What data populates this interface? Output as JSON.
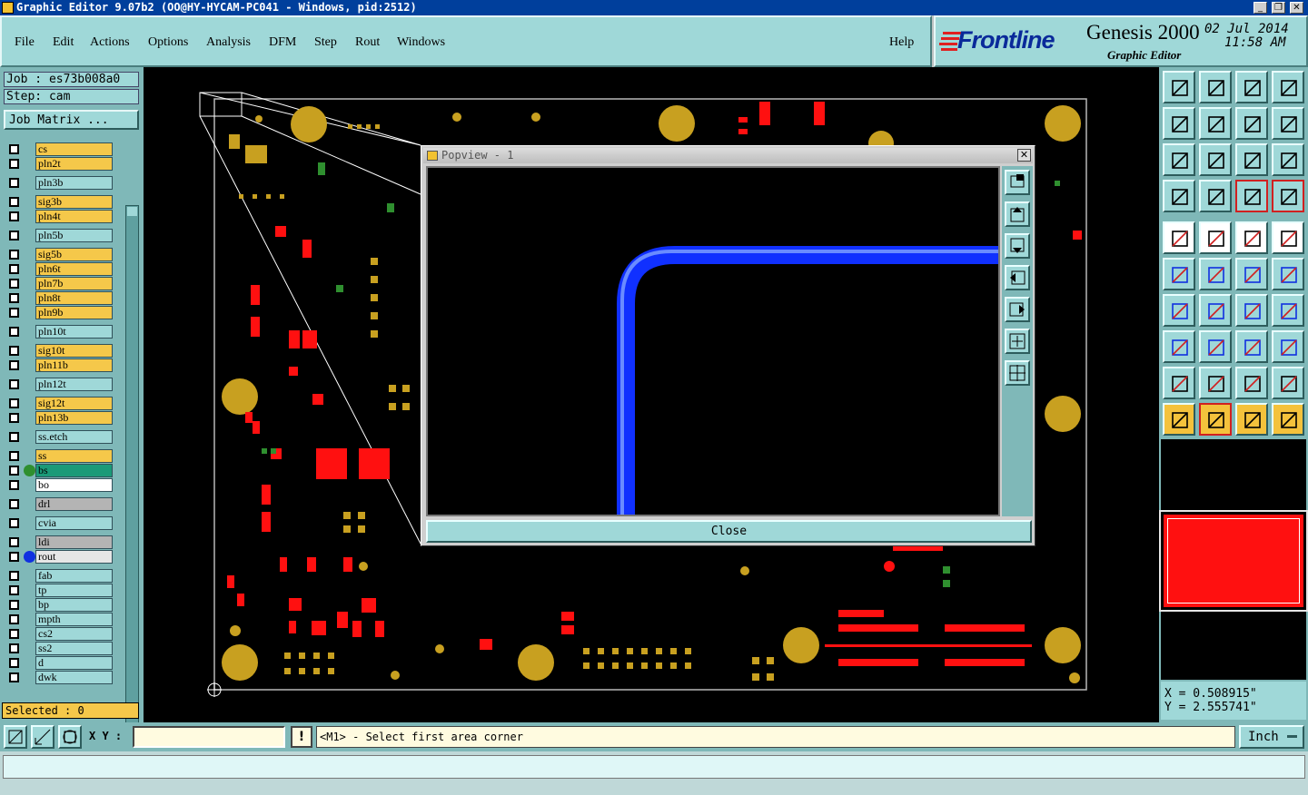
{
  "window": {
    "title": "Graphic Editor 9.07b2 (OO@HY-HYCAM-PC041 - Windows, pid:2512)",
    "minimize_glyph": "_",
    "restore_glyph": "❐",
    "close_glyph": "✕"
  },
  "menu": [
    {
      "label": "File"
    },
    {
      "label": "Edit"
    },
    {
      "label": "Actions"
    },
    {
      "label": "Options"
    },
    {
      "label": "Analysis"
    },
    {
      "label": "DFM"
    },
    {
      "label": "Step"
    },
    {
      "label": "Rout"
    },
    {
      "label": "Windows"
    },
    {
      "label": "Help"
    }
  ],
  "brand": {
    "logo": "Frontline",
    "product": "Genesis 2000",
    "subtitle": "Graphic Editor",
    "date": "02 Jul 2014",
    "time": "11:58 AM"
  },
  "job": {
    "job_line": "Job : es73b008a0",
    "step_line": "Step: cam",
    "matrix_button": "Job Matrix ..."
  },
  "layers": [
    {
      "name": "cs",
      "color": "#f5c84a"
    },
    {
      "name": "pln2t",
      "color": "#f5c84a"
    },
    {
      "name": "pln3b",
      "color": "#9fd8d8"
    },
    {
      "name": "sig3b",
      "color": "#f5c84a"
    },
    {
      "name": "pln4t",
      "color": "#f5c84a"
    },
    {
      "name": "pln5b",
      "color": "#9fd8d8"
    },
    {
      "name": "sig5b",
      "color": "#f5c84a"
    },
    {
      "name": "pln6t",
      "color": "#f5c84a"
    },
    {
      "name": "pln7b",
      "color": "#f5c84a"
    },
    {
      "name": "pln8t",
      "color": "#f5c84a"
    },
    {
      "name": "pln9b",
      "color": "#f5c84a"
    },
    {
      "name": "pln10t",
      "color": "#9fd8d8"
    },
    {
      "name": "sig10t",
      "color": "#f5c84a"
    },
    {
      "name": "pln11b",
      "color": "#f5c84a"
    },
    {
      "name": "pln12t",
      "color": "#9fd8d8"
    },
    {
      "name": "sig12t",
      "color": "#f5c84a"
    },
    {
      "name": "pln13b",
      "color": "#f5c84a"
    },
    {
      "name": "ss.etch",
      "color": "#9fd8d8"
    },
    {
      "name": "ss",
      "color": "#f5c84a"
    },
    {
      "name": "bs",
      "color": "#1a9a78",
      "dot": "#2f8f2f"
    },
    {
      "name": "bo",
      "color": "#ffffff",
      "mark": "✎"
    },
    {
      "name": "drl",
      "color": "#b4b4b4"
    },
    {
      "name": "cvia",
      "color": "#9fd8d8"
    },
    {
      "name": "ldi",
      "color": "#b4b4b4"
    },
    {
      "name": "rout",
      "color": "#e6e6e6",
      "dot": "#1030e0"
    },
    {
      "name": "fab",
      "color": "#9fd8d8",
      "mark": "✎"
    },
    {
      "name": "tp",
      "color": "#9fd8d8"
    },
    {
      "name": "bp",
      "color": "#9fd8d8"
    },
    {
      "name": "mpth",
      "color": "#9fd8d8"
    },
    {
      "name": "cs2",
      "color": "#9fd8d8"
    },
    {
      "name": "ss2",
      "color": "#9fd8d8"
    },
    {
      "name": "d",
      "color": "#9fd8d8"
    },
    {
      "name": "dwk",
      "color": "#9fd8d8"
    }
  ],
  "selected_label": "Selected : 0",
  "popup": {
    "title": "Popview - 1",
    "close_button": "Close",
    "close_glyph": "✕"
  },
  "coords": {
    "x_line": "X = 0.508915\"",
    "y_line": "Y = 2.555741\""
  },
  "status": {
    "xy_label": "X Y :",
    "xy_value": "",
    "alert_glyph": "!",
    "message": "<M1> - Select first area corner",
    "units": "Inch"
  },
  "colors": {
    "panel": "#9fd8d8",
    "panel_dark": "#7fb8b8",
    "pad_gold": "#c8a020",
    "pad_red": "#ff1010",
    "pad_green": "#2f8f2f",
    "trace_blue": "#1030ff"
  }
}
